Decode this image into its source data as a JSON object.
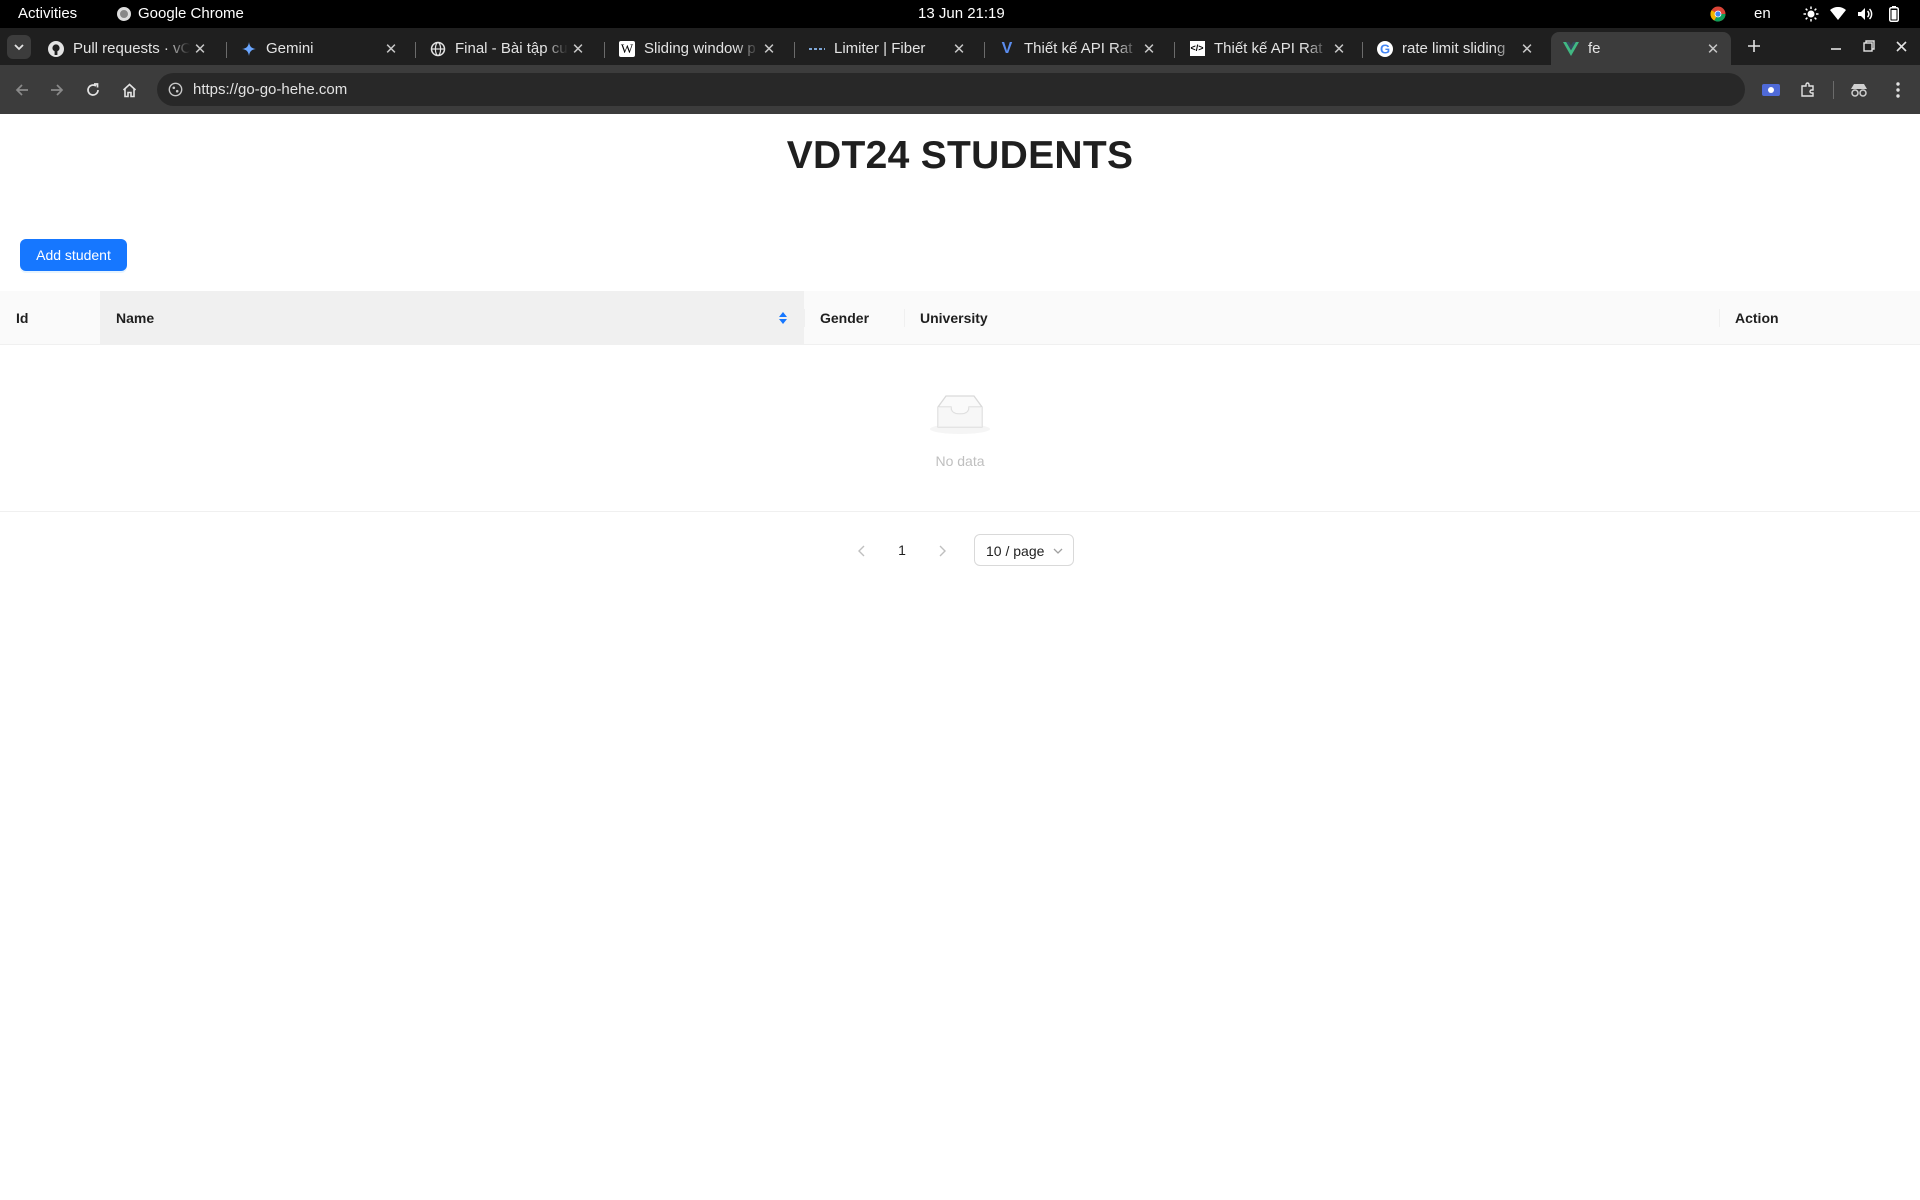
{
  "system_bar": {
    "activities": "Activities",
    "app_name": "Google Chrome",
    "clock": "13 Jun  21:19",
    "language": "en"
  },
  "browser": {
    "tabs": [
      {
        "title": "Pull requests · vC",
        "icon": "github-icon"
      },
      {
        "title": "Gemini",
        "icon": "gemini-sparkle-icon"
      },
      {
        "title": "Final - Bài tập cu",
        "icon": "globe-icon"
      },
      {
        "title": "Sliding window p",
        "icon": "wikipedia-icon"
      },
      {
        "title": "Limiter | Fiber",
        "icon": "fiber-icon"
      },
      {
        "title": "Thiết kế API Rat",
        "icon": "viblo-icon"
      },
      {
        "title": "Thiết kế API Rat",
        "icon": "doc-icon"
      },
      {
        "title": "rate limit sliding",
        "icon": "google-icon"
      },
      {
        "title": "fe",
        "icon": "vue-icon",
        "active": true
      }
    ],
    "url": "https://go-go-hehe.com"
  },
  "page": {
    "title": "VDT24 STUDENTS",
    "add_button": "Add student",
    "table": {
      "columns": [
        "Id",
        "Name",
        "Gender",
        "University",
        "Action"
      ],
      "rows": [],
      "empty_text": "No data"
    },
    "pagination": {
      "prev": "<",
      "current_page": "1",
      "next": ">",
      "page_size": "10 / page"
    }
  },
  "colors": {
    "primary": "#1677ff",
    "header_bg": "#fafafa",
    "sorted_header_bg": "#f0f0f0"
  }
}
